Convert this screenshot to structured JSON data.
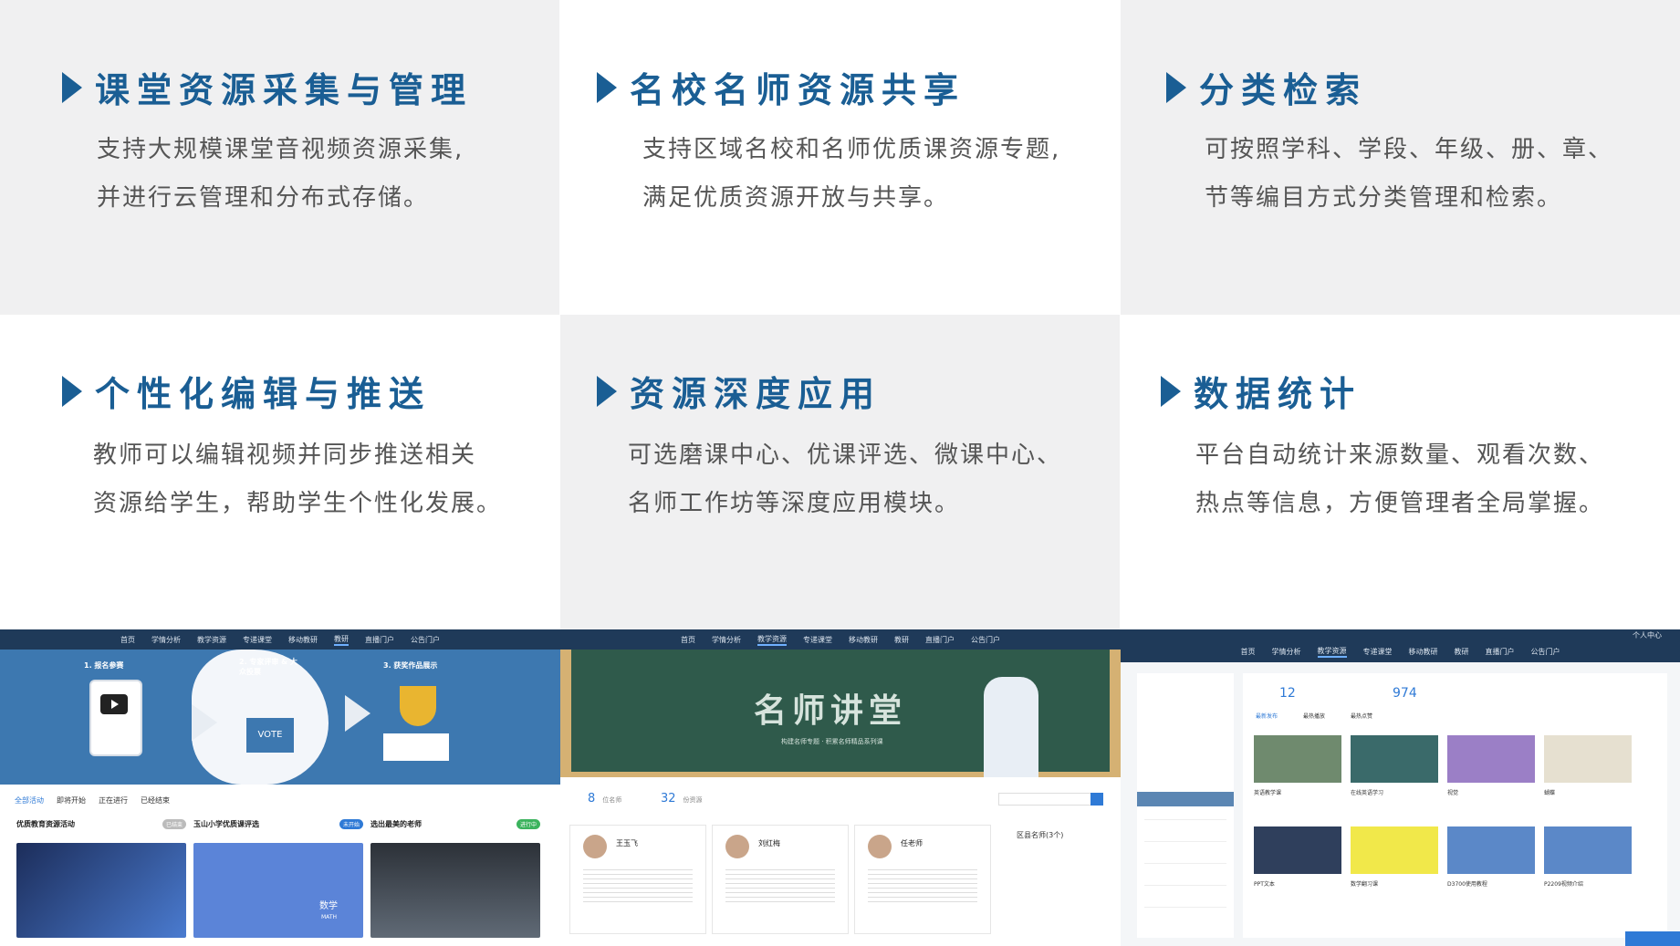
{
  "features": [
    {
      "title": "课堂资源采集与管理",
      "desc1": "支持大规模课堂音视频资源采集,",
      "desc2": "并进行云管理和分布式存储。"
    },
    {
      "title": "名校名师资源共享",
      "desc1": "支持区域名校和名师优质课资源专题,",
      "desc2": "满足优质资源开放与共享。"
    },
    {
      "title": "分类检索",
      "desc1": "可按照学科、学段、年级、册、章、",
      "desc2": "节等编目方式分类管理和检索。"
    },
    {
      "title": "个性化编辑与推送",
      "desc1": "教师可以编辑视频并同步推送相关",
      "desc2": "资源给学生，帮助学生个性化发展。"
    },
    {
      "title": "资源深度应用",
      "desc1": "可选磨课中心、优课评选、微课中心、",
      "desc2": "名师工作坊等深度应用模块。"
    },
    {
      "title": "数据统计",
      "desc1": "平台自动统计来源数量、观看次数、",
      "desc2": "热点等信息，方便管理者全局掌握。"
    }
  ],
  "nav1": [
    "首页",
    "学情分析",
    "教学资源",
    "专递课堂",
    "移动教研",
    "教研",
    "直播门户",
    "公告门户"
  ],
  "nav2": [
    "首页",
    "学情分析",
    "教学资源",
    "专递课堂",
    "移动教研",
    "教研",
    "直播门户",
    "公告门户"
  ],
  "nav3": [
    "首页",
    "学情分析",
    "教学资源",
    "专递课堂",
    "移动教研",
    "教研",
    "直播门户",
    "公告门户"
  ],
  "shot1": {
    "step1": "1. 报名参赛",
    "step2": "2. 专家评审 & 大众投票",
    "step3": "3. 获奖作品展示",
    "vote": "VOTE",
    "tabs": [
      "全部活动",
      "即将开始",
      "正在进行",
      "已经结束"
    ],
    "cards": [
      {
        "title": "优质教育资源活动",
        "badge": "已结束"
      },
      {
        "title": "玉山小学优质课评选",
        "badge": "未开始"
      },
      {
        "title": "选出最美的老师",
        "badge": "进行中"
      }
    ],
    "math": "数学",
    "math_en": "MATH"
  },
  "shot2": {
    "board_title": "名师讲堂",
    "board_sub": "构建名师专题 · 积累名师精品系列课",
    "teacher_count": "8",
    "teacher_label": "位名师",
    "resource_count": "32",
    "resource_label": "份资源",
    "teachers": [
      "王玉飞",
      "刘红梅",
      "任老师"
    ],
    "side_title": "区县名师(3个)"
  },
  "shot3": {
    "personal": "个人中心",
    "count1": "12",
    "count2": "974",
    "tabs": [
      "最新发布",
      "最热播放",
      "最热点赞"
    ],
    "captions": [
      "英语教学课",
      "在线英语学习",
      "视觉",
      "蝴蝶",
      "PPT文本",
      "数学翻习课",
      "D3700使用教程",
      "P2209视频介绍"
    ]
  }
}
